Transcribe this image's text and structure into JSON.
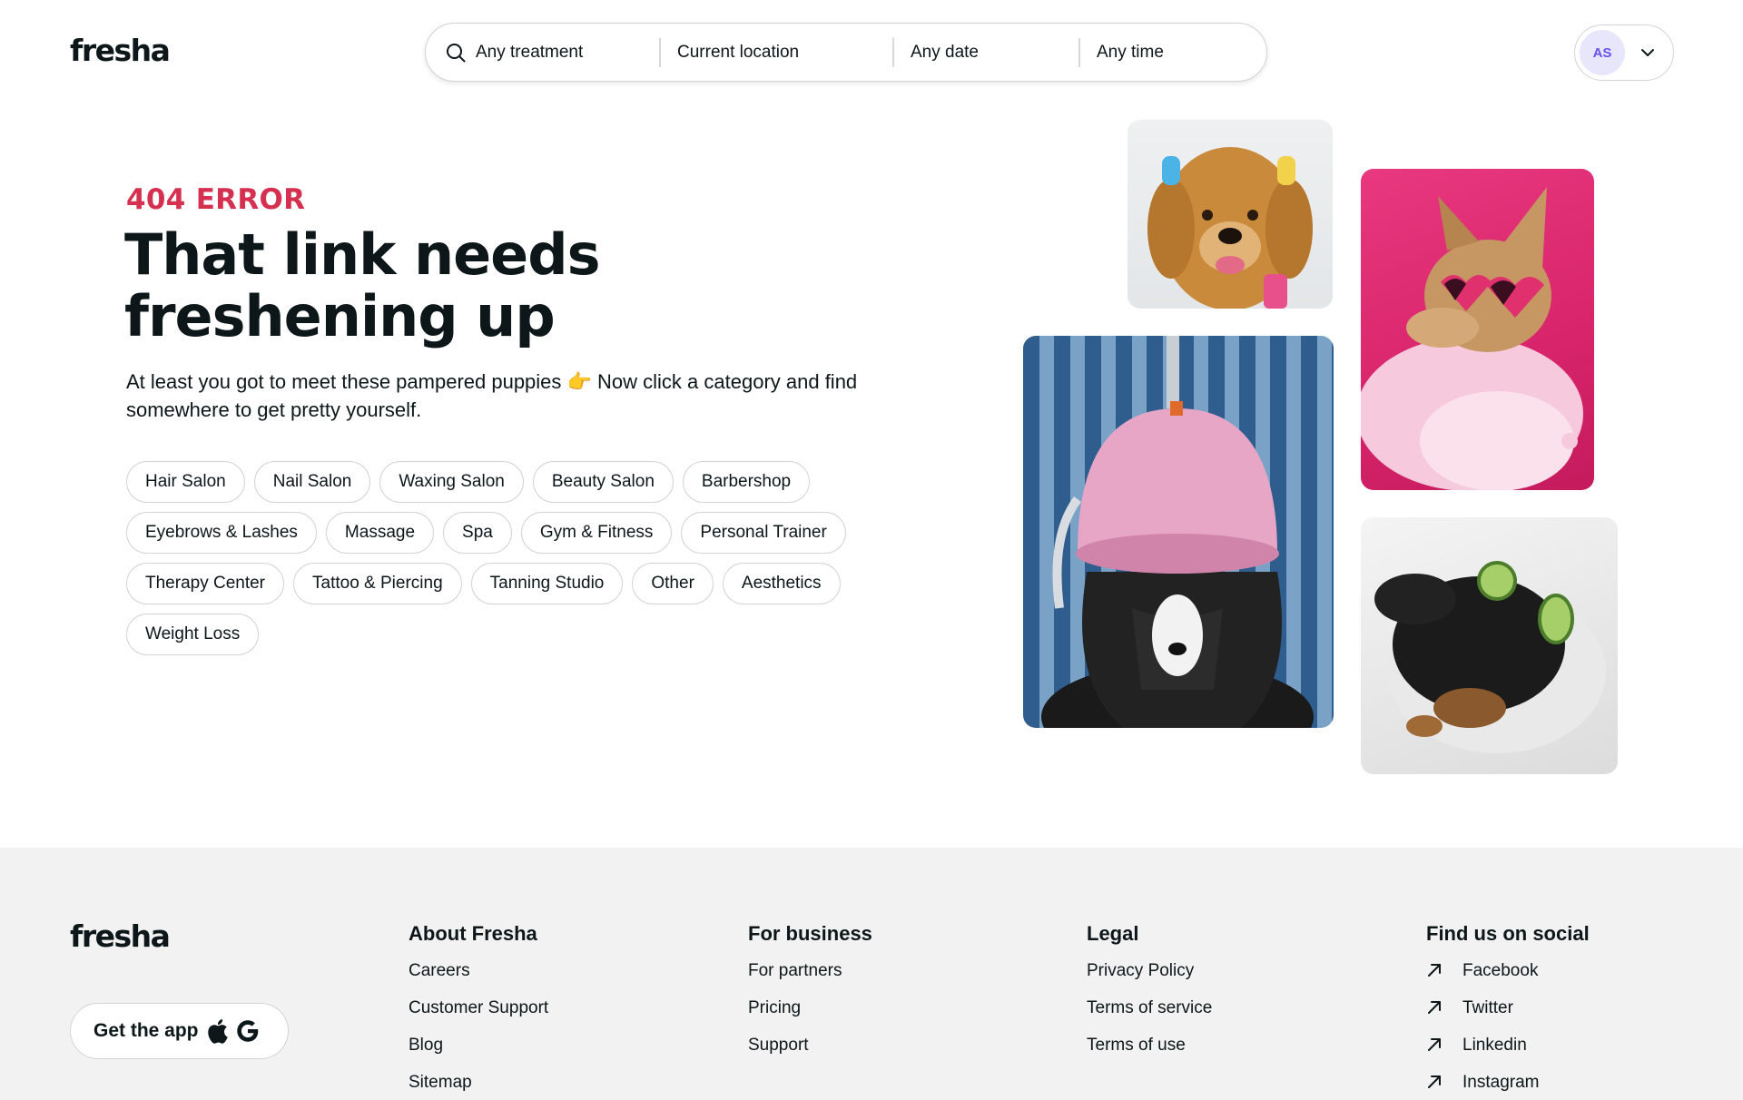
{
  "header": {
    "logo": "fresha",
    "search": {
      "treatment": "Any treatment",
      "location": "Current location",
      "date": "Any date",
      "time": "Any time"
    },
    "user_initials": "AS"
  },
  "hero": {
    "error_label": "404 ERROR",
    "title": "That link needs freshening up",
    "description": "At least you got to meet these pampered puppies 👉 Now click a category and find somewhere to get pretty yourself.",
    "categories": [
      "Hair Salon",
      "Nail Salon",
      "Waxing Salon",
      "Beauty Salon",
      "Barbershop",
      "Eyebrows & Lashes",
      "Massage",
      "Spa",
      "Gym & Fitness",
      "Personal Trainer",
      "Therapy Center",
      "Tattoo & Piercing",
      "Tanning Studio",
      "Other",
      "Aesthetics",
      "Weight Loss"
    ]
  },
  "footer": {
    "logo": "fresha",
    "app_button": "Get the app",
    "columns": [
      {
        "title": "About Fresha",
        "links": [
          "Careers",
          "Customer Support",
          "Blog",
          "Sitemap"
        ]
      },
      {
        "title": "For business",
        "links": [
          "For partners",
          "Pricing",
          "Support"
        ]
      },
      {
        "title": "Legal",
        "links": [
          "Privacy Policy",
          "Terms of service",
          "Terms of use"
        ]
      },
      {
        "title": "Find us on social",
        "links": [
          "Facebook",
          "Twitter",
          "Linkedin",
          "Instagram"
        ]
      }
    ]
  },
  "colors": {
    "accent_error": "#d5304f",
    "avatar_bg": "#e7e6fb",
    "avatar_text": "#6950f3",
    "footer_bg": "#f2f2f2"
  }
}
